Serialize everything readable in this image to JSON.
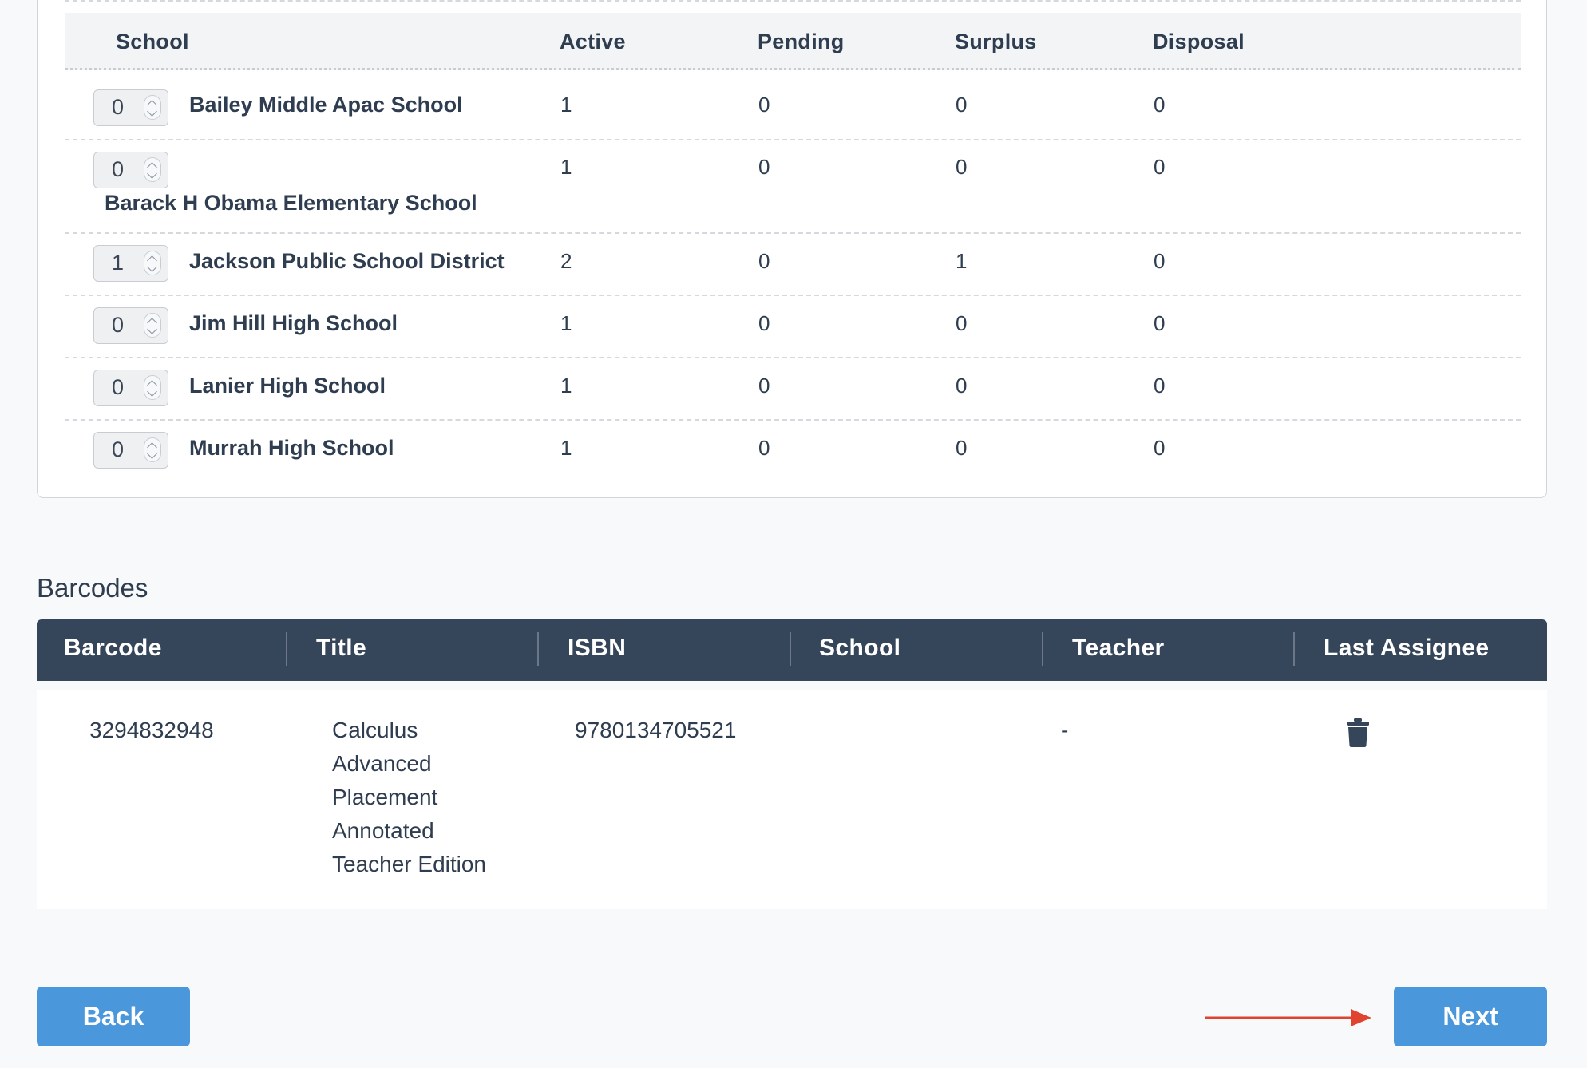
{
  "schools_table": {
    "headers": {
      "school": "School",
      "active": "Active",
      "pending": "Pending",
      "surplus": "Surplus",
      "disposal": "Disposal"
    },
    "rows": [
      {
        "qty": "0",
        "school": "Bailey Middle Apac School",
        "active": "1",
        "pending": "0",
        "surplus": "0",
        "disposal": "0"
      },
      {
        "qty": "0",
        "school": "Barack H Obama Elementary School",
        "active": "1",
        "pending": "0",
        "surplus": "0",
        "disposal": "0"
      },
      {
        "qty": "1",
        "school": "Jackson Public School District",
        "active": "2",
        "pending": "0",
        "surplus": "1",
        "disposal": "0"
      },
      {
        "qty": "0",
        "school": "Jim Hill High School",
        "active": "1",
        "pending": "0",
        "surplus": "0",
        "disposal": "0"
      },
      {
        "qty": "0",
        "school": "Lanier High School",
        "active": "1",
        "pending": "0",
        "surplus": "0",
        "disposal": "0"
      },
      {
        "qty": "0",
        "school": "Murrah High School",
        "active": "1",
        "pending": "0",
        "surplus": "0",
        "disposal": "0"
      }
    ]
  },
  "barcodes": {
    "section_title": "Barcodes",
    "headers": {
      "barcode": "Barcode",
      "title": "Title",
      "isbn": "ISBN",
      "school": "School",
      "teacher": "Teacher",
      "last_assignee": "Last Assignee"
    },
    "rows": [
      {
        "barcode": "3294832948",
        "title_lines": [
          "Calculus",
          "Advanced",
          "Placement",
          "Annotated",
          "Teacher Edition"
        ],
        "isbn": "9780134705521",
        "school": "",
        "teacher": "-",
        "delete_icon": "trash-icon"
      }
    ]
  },
  "footer": {
    "back_label": "Back",
    "next_label": "Next",
    "arrow_color": "#e0432f"
  },
  "colors": {
    "header_dark": "#36465a",
    "button_blue": "#4a97dc",
    "text": "#2f3d50"
  }
}
